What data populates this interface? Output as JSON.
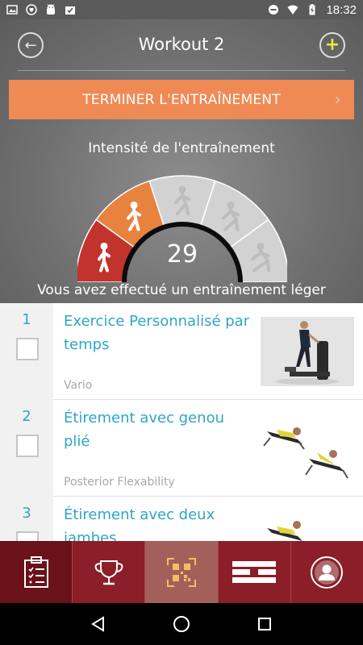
{
  "status_bar": {
    "time": "18:32",
    "left_icons": [
      "image-icon",
      "shield-icon",
      "android-icon",
      "clipboard-check-icon"
    ],
    "right_icons": [
      "do-not-disturb-icon",
      "wifi-icon",
      "battery-charging-icon"
    ]
  },
  "header": {
    "title": "Workout 2",
    "back_icon": "arrow-left-icon",
    "add_icon": "plus-icon",
    "add_symbol": "+",
    "back_symbol": "←"
  },
  "finish_button": {
    "label": "TERMINER L'ENTRAÎNEMENT",
    "chevron": "›"
  },
  "intensity": {
    "label": "Intensité de l'entraînement",
    "value": "29",
    "value_number": 29,
    "levels": [
      "standing",
      "walking",
      "walking-fast",
      "running",
      "sprinting"
    ],
    "active_level_index": 1,
    "result_text": "Vous avez effectué un entraînement léger",
    "colors": {
      "level_1": "#c2332d",
      "level_2": "#e8823f",
      "inactive": "#d2d2d2"
    }
  },
  "exercises": [
    {
      "number": "1",
      "title": "Exercice Personnalisé par temps",
      "subtitle": "Vario",
      "checked": false,
      "image": "vario-machine-image"
    },
    {
      "number": "2",
      "title": "Étirement avec genou plié",
      "subtitle": "Posterior Flexability",
      "checked": false,
      "image": "stretch-bent-knee-image"
    },
    {
      "number": "3",
      "title": "Étirement avec deux jambes",
      "subtitle": "",
      "checked": false,
      "image": "stretch-two-legs-image"
    }
  ],
  "tabs": [
    {
      "name": "workout-list",
      "icon": "clipboard-list-icon",
      "active": true
    },
    {
      "name": "trophies",
      "icon": "trophy-icon",
      "active": false
    },
    {
      "name": "qr-scan",
      "icon": "qr-code-icon",
      "active": false
    },
    {
      "name": "timeline",
      "icon": "bars-icon",
      "active": false
    },
    {
      "name": "profile",
      "icon": "user-avatar-icon",
      "active": false
    }
  ],
  "nav_bar": [
    "back-triangle-icon",
    "home-circle-icon",
    "recents-square-icon"
  ],
  "colors": {
    "accent_blue": "#2ea6c4",
    "finish_orange": "#f08a55",
    "tab_bar_red": "#8b1e28",
    "tab_active": "#6a1119"
  }
}
